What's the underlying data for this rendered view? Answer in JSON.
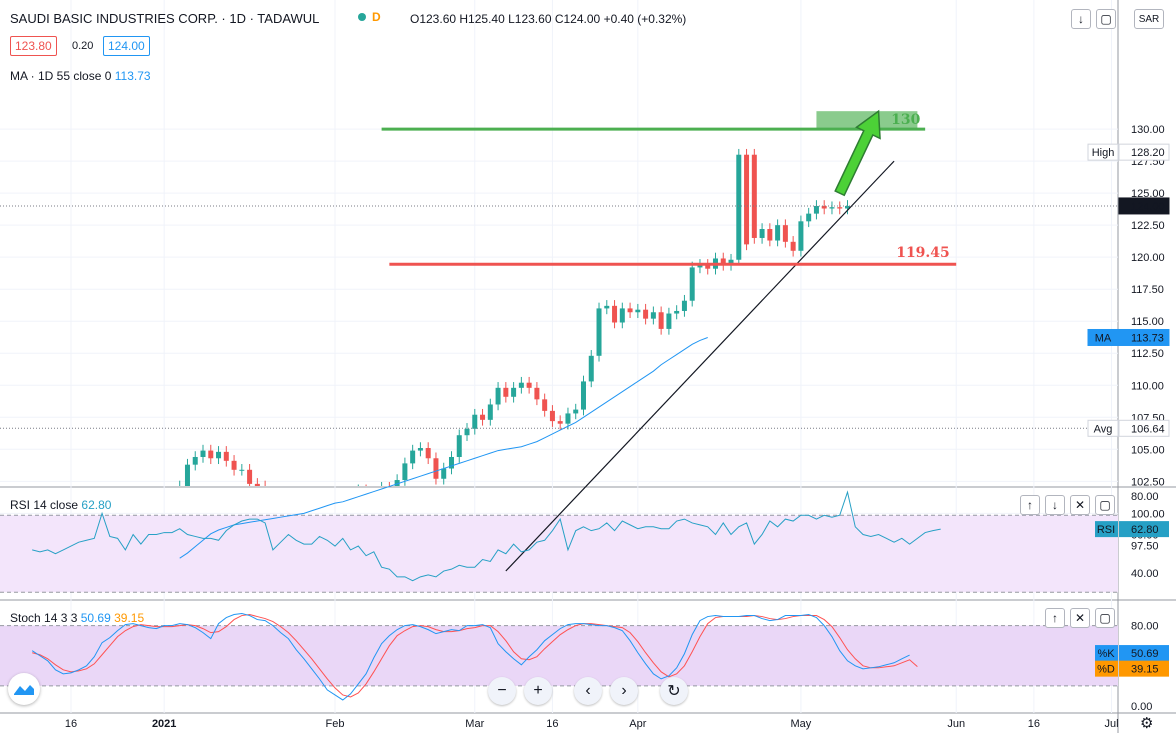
{
  "header": {
    "symbol_title": "SAUDI BASIC INDUSTRIES CORP. · 1D · TADAWUL",
    "delay_badge": "D",
    "ohlc": {
      "open": "O123.60",
      "high": "H125.40",
      "low": "L123.60",
      "close": "C124.00",
      "change": "+0.40 (+0.32%)"
    },
    "bid": "123.80",
    "spread": "0.20",
    "ask": "124.00",
    "ma_label": "MA · 1D 55 close 0",
    "ma_value": "113.73",
    "currency": "SAR"
  },
  "colors": {
    "up": "#26a69a",
    "down": "#ef5350",
    "ma": "#2196f3",
    "rsi": "#26a0c5",
    "stoch_k": "#2196f3",
    "stoch_d": "#ff5252",
    "resistance": "#4caf50",
    "support": "#ef5350",
    "arrow": "#4cd137"
  },
  "chart_data": [
    {
      "type": "candlestick",
      "title": "SAUDI BASIC INDUSTRIES CORP. · 1D · TADAWUL",
      "ylim": [
        95.5,
        133
      ],
      "y_ticks": [
        "97.50",
        "100.00",
        "102.50",
        "105.00",
        "107.50",
        "110.00",
        "112.50",
        "115.00",
        "117.50",
        "120.00",
        "122.50",
        "125.00",
        "127.50",
        "130.00"
      ],
      "x_ticks": [
        "16",
        "2021",
        "Feb",
        "Mar",
        "16",
        "Apr",
        "May",
        "Jun",
        "16",
        "Jul"
      ],
      "x_tick_day": [
        0,
        12,
        34,
        52,
        62,
        73,
        94,
        114,
        124,
        134
      ],
      "price_axis_labels": [
        {
          "tag": "High",
          "value": "128.20"
        },
        {
          "tag": "",
          "value": "124.00"
        },
        {
          "tag": "MA",
          "value": "113.73"
        },
        {
          "tag": "Avg",
          "value": "106.64"
        }
      ],
      "day_index": [
        -5,
        -4,
        -3,
        -2,
        -1,
        0,
        1,
        2,
        3,
        4,
        5,
        6,
        7,
        8,
        9,
        10,
        11,
        12,
        13,
        14,
        15,
        16,
        17,
        18,
        19,
        20,
        21,
        22,
        23,
        24,
        25,
        26,
        27,
        28,
        29,
        30,
        31,
        32,
        33,
        34,
        35,
        36,
        37,
        38,
        39,
        40,
        41,
        42,
        43,
        44,
        45,
        46,
        47,
        48,
        49,
        50,
        51,
        52,
        53,
        54,
        55,
        56,
        57,
        58,
        59,
        60,
        61,
        62,
        63,
        64,
        65,
        66,
        67,
        68,
        69,
        70,
        71,
        72,
        73,
        74,
        75,
        76,
        77,
        78,
        79,
        80,
        81,
        82,
        83,
        84,
        85,
        86,
        87,
        88,
        89,
        90,
        91,
        92,
        93,
        94,
        95,
        96,
        97,
        98,
        99,
        100,
        101,
        102,
        103,
        104,
        105,
        106
      ],
      "open": [
        96.2,
        96.5,
        96.9,
        97.5,
        97.8,
        97.6,
        99.7,
        100.6,
        98.2,
        100.0,
        100.5,
        100.1,
        100.7,
        100.4,
        100.8,
        100.5,
        100.3,
        99.8,
        100.1,
        100.8,
        102.1,
        103.8,
        104.4,
        104.9,
        104.3,
        104.8,
        104.1,
        103.4,
        103.4,
        102.3,
        102.1,
        101.5,
        101.3,
        100.1,
        99.6,
        99.0,
        98.0,
        97.6,
        98.0,
        98.6,
        100.5,
        100.3,
        101.0,
        101.8,
        101.2,
        101.5,
        102.0,
        101.6,
        102.6,
        103.9,
        104.9,
        105.1,
        104.3,
        102.7,
        103.5,
        104.4,
        106.1,
        106.6,
        107.7,
        107.3,
        108.5,
        109.8,
        109.1,
        109.8,
        110.2,
        109.8,
        108.9,
        108.0,
        107.2,
        107.0,
        107.8,
        108.1,
        110.3,
        112.3,
        116.0,
        116.2,
        114.9,
        116.0,
        115.7,
        115.9,
        115.2,
        115.7,
        114.4,
        115.6,
        115.8,
        116.6,
        119.2,
        119.4,
        119.1,
        119.9,
        119.4,
        119.8,
        128.0,
        128.0,
        121.5,
        122.2,
        121.3,
        122.5,
        121.2,
        120.5,
        122.8,
        123.4,
        124.0,
        123.8,
        123.9,
        123.8
      ],
      "close": [
        96.5,
        96.9,
        97.5,
        97.8,
        97.6,
        99.7,
        100.6,
        98.2,
        100.0,
        100.5,
        100.1,
        100.7,
        100.4,
        100.8,
        100.5,
        100.3,
        99.8,
        100.1,
        100.8,
        102.1,
        103.8,
        104.4,
        104.9,
        104.3,
        104.8,
        104.1,
        103.4,
        103.4,
        102.3,
        102.1,
        101.5,
        101.3,
        100.1,
        99.6,
        99.0,
        98.0,
        97.6,
        98.0,
        98.6,
        100.5,
        100.3,
        101.0,
        101.8,
        101.2,
        101.5,
        102.0,
        101.6,
        102.6,
        103.9,
        104.9,
        105.1,
        104.3,
        102.7,
        103.5,
        104.4,
        106.1,
        106.6,
        107.7,
        107.3,
        108.5,
        109.8,
        109.1,
        109.8,
        110.2,
        109.8,
        108.9,
        108.0,
        107.2,
        107.0,
        107.8,
        108.1,
        110.3,
        112.3,
        116.0,
        116.2,
        114.9,
        116.0,
        115.7,
        115.9,
        115.2,
        115.7,
        114.4,
        115.6,
        115.8,
        116.6,
        119.2,
        119.4,
        119.1,
        119.9,
        119.4,
        119.8,
        128.0,
        121.0,
        121.5,
        122.2,
        121.3,
        122.5,
        121.2,
        120.5,
        122.8,
        123.4,
        124.0,
        123.8,
        123.9,
        123.8,
        124.0
      ],
      "ma_start_day": 14,
      "ma": [
        96.5,
        96.9,
        97.4,
        97.9,
        98.4,
        98.7,
        98.9,
        99.1,
        99.2,
        99.3,
        99.4,
        99.5,
        99.6,
        99.7,
        99.8,
        99.9,
        100.0,
        100.2,
        100.4,
        100.6,
        100.8,
        100.9,
        101.1,
        101.3,
        101.5,
        101.7,
        101.9,
        102.1,
        102.3,
        102.5,
        102.7,
        102.9,
        103.1,
        103.3,
        103.5,
        103.7,
        103.9,
        104.1,
        104.3,
        104.5,
        104.7,
        104.9,
        105.0,
        105.1,
        105.2,
        105.4,
        105.6,
        105.9,
        106.2,
        106.5,
        106.8,
        107.1,
        107.5,
        107.9,
        108.3,
        108.7,
        109.1,
        109.5,
        109.9,
        110.3,
        110.7,
        111.1,
        111.6,
        112.0,
        112.4,
        112.8,
        113.2,
        113.5,
        113.73
      ],
      "resistance": {
        "value": 130,
        "label": "130",
        "start_day": 40,
        "end_day": 110
      },
      "support": {
        "value": 119.45,
        "label": "119.45",
        "start_day": 41,
        "end_day": 114
      },
      "trendline": {
        "start": [
          56,
          95.5
        ],
        "end": [
          106,
          127.5
        ]
      },
      "target_zone": {
        "start_day": 96,
        "end_day": 109,
        "low": 130.0,
        "high": 131.4
      },
      "arrow": {
        "from": [
          99,
          125
        ],
        "to": [
          104,
          131.4
        ]
      }
    },
    {
      "type": "line",
      "title": "RSI 14 close",
      "value_label": "62.80",
      "ylim": [
        20,
        84
      ],
      "y_ticks": [
        "40.00",
        "60.00",
        "80.00"
      ],
      "band": [
        30,
        70
      ],
      "start_day": -5,
      "values": [
        52,
        51,
        52,
        50,
        52,
        54,
        56,
        57,
        58,
        71,
        59,
        58,
        52,
        60,
        55,
        60,
        60,
        61,
        61,
        63,
        60,
        59,
        58,
        58,
        57,
        62,
        65,
        67,
        68,
        68,
        66,
        52,
        56,
        60,
        57,
        55,
        55,
        59,
        57,
        54,
        58,
        52,
        54,
        49,
        51,
        43,
        42,
        38,
        38,
        36,
        38,
        39,
        38,
        41,
        42,
        44,
        43,
        43,
        47,
        46,
        52,
        50,
        55,
        51,
        52,
        56,
        57,
        62,
        68,
        52,
        62,
        64,
        62,
        63,
        66,
        62,
        67,
        65,
        63,
        64,
        64,
        63,
        63,
        67,
        68,
        66,
        65,
        64,
        60,
        66,
        60,
        64,
        66,
        55,
        60,
        67,
        64,
        68,
        67,
        70,
        70,
        68,
        70,
        69,
        70,
        82,
        64,
        60,
        59,
        60,
        58,
        56,
        58,
        55,
        58,
        61,
        62,
        62.8
      ]
    },
    {
      "type": "line",
      "title": "Stoch 14 3 3",
      "k_label": "50.69",
      "d_label": "39.15",
      "ylim": [
        -5,
        105
      ],
      "y_ticks": [
        "0.00",
        "80.00"
      ],
      "band": [
        20,
        80
      ],
      "start_day": -5,
      "k": [
        55,
        50,
        45,
        36,
        32,
        33,
        36,
        40,
        49,
        63,
        68,
        75,
        81,
        82,
        80,
        78,
        77,
        80,
        80,
        82,
        81,
        78,
        73,
        67,
        82,
        88,
        91,
        92,
        90,
        86,
        85,
        80,
        73,
        67,
        56,
        47,
        37,
        27,
        16,
        11,
        6,
        12,
        22,
        32,
        48,
        62,
        70,
        76,
        80,
        81,
        79,
        76,
        72,
        74,
        76,
        75,
        80,
        80,
        81,
        78,
        62,
        54,
        47,
        41,
        49,
        56,
        65,
        71,
        77,
        81,
        82,
        82,
        81,
        80,
        80,
        78,
        75,
        65,
        53,
        42,
        32,
        27,
        30,
        38,
        52,
        71,
        85,
        89,
        90,
        89,
        89,
        89,
        90,
        90,
        87,
        85,
        86,
        90,
        90,
        90,
        91,
        88,
        80,
        69,
        55,
        45,
        40,
        37,
        38,
        39,
        41,
        43,
        47,
        50.69
      ],
      "d": [
        53,
        51,
        47,
        41,
        36,
        34,
        35,
        37,
        42,
        51,
        60,
        69,
        75,
        79,
        81,
        80,
        79,
        79,
        79,
        80,
        81,
        80,
        77,
        73,
        74,
        79,
        86,
        90,
        91,
        89,
        87,
        84,
        79,
        73,
        65,
        56,
        47,
        37,
        27,
        18,
        11,
        9,
        13,
        22,
        34,
        47,
        60,
        70,
        75,
        79,
        80,
        79,
        76,
        74,
        74,
        75,
        77,
        78,
        80,
        80,
        74,
        65,
        54,
        47,
        46,
        49,
        57,
        64,
        71,
        76,
        80,
        82,
        82,
        81,
        80,
        79,
        78,
        73,
        64,
        53,
        43,
        34,
        29,
        32,
        40,
        54,
        69,
        82,
        88,
        89,
        89,
        89,
        89,
        90,
        89,
        87,
        86,
        87,
        89,
        90,
        90,
        90,
        86,
        79,
        68,
        56,
        47,
        40,
        38,
        38,
        39,
        40,
        43,
        46,
        39.15
      ]
    }
  ]
}
